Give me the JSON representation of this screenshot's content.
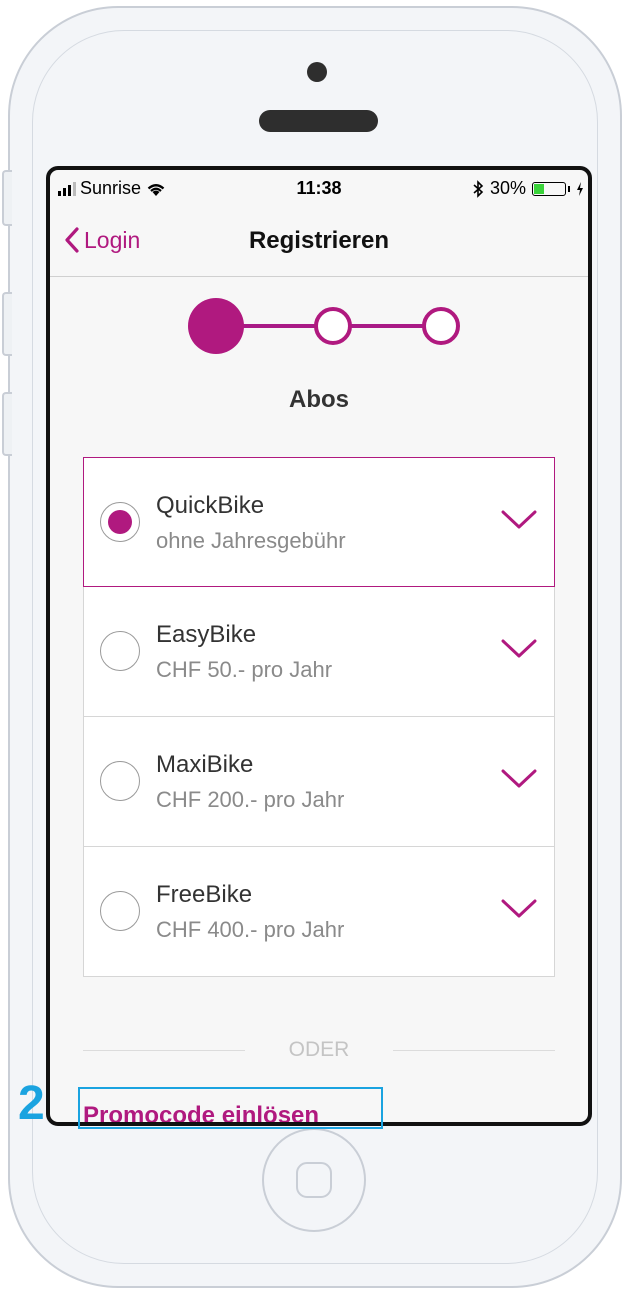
{
  "status_bar": {
    "carrier": "Sunrise",
    "time": "11:38",
    "battery_percent": "30%",
    "battery_level": 0.3
  },
  "nav": {
    "back_label": "Login",
    "title": "Registrieren"
  },
  "stepper": {
    "current_step": 1,
    "total_steps": 3
  },
  "section": {
    "title": "Abos"
  },
  "subscriptions": [
    {
      "name": "QuickBike",
      "price": "ohne Jahresgebühr",
      "selected": true
    },
    {
      "name": "EasyBike",
      "price": "CHF 50.- pro Jahr",
      "selected": false
    },
    {
      "name": "MaxiBike",
      "price": "CHF 200.- pro Jahr",
      "selected": false
    },
    {
      "name": "FreeBike",
      "price": "CHF 400.- pro Jahr",
      "selected": false
    }
  ],
  "divider_label": "ODER",
  "promo_link": "Promocode einlösen",
  "annotation": {
    "number": "2"
  },
  "colors": {
    "accent": "#b0197f",
    "annotation": "#1aa3e0",
    "battery": "#3ad33a"
  }
}
